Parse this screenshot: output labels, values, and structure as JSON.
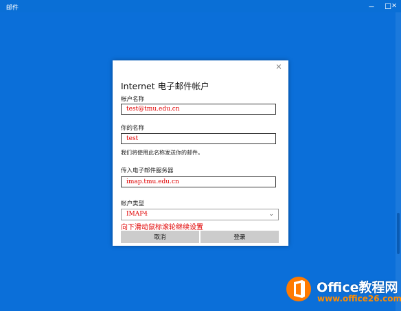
{
  "window": {
    "title": "邮件",
    "minimize_glyph": "—",
    "maximize_glyph": "☐",
    "close_glyph": "✕"
  },
  "dialog": {
    "close_glyph": "✕",
    "title": "Internet 电子邮件帐户",
    "account_name_label": "帐户名称",
    "account_name_value": "test@tmu.edu.cn",
    "your_name_label": "你的名称",
    "your_name_value": "test",
    "send_note": "我们将使用此名称发送你的邮件。",
    "incoming_server_label": "传入电子邮件服务器",
    "incoming_server_value": "imap.tmu.edu.cn",
    "account_type_label": "帐户类型",
    "account_type_value": "IMAP4",
    "scroll_hint": "向下滑动鼠标滚轮继续设置",
    "cancel_label": "取消",
    "login_label": "登录"
  },
  "watermark": {
    "brand": "Office教程网",
    "url": "www.office26.com"
  },
  "colors": {
    "background": "#0b6fd9",
    "annotation": "#e00000",
    "watermark_accent": "#ff8c00"
  }
}
